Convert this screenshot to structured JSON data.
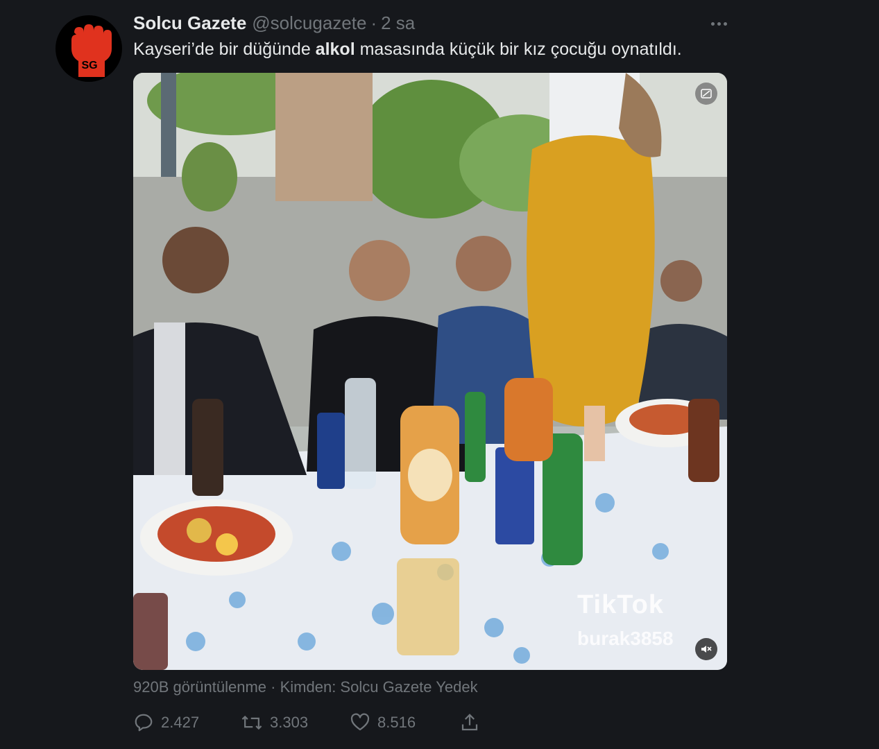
{
  "tweet": {
    "author_name": "Solcu Gazete",
    "handle": "@solcugazete",
    "separator": "·",
    "time": "2 sa",
    "avatar_text": "SG",
    "text_before": "Kayseri’de bir düğünde ",
    "text_bold": "alkol",
    "text_after": " masasında küçük bir kız çocuğu oynatıldı.",
    "more_icon": "more-dots-icon"
  },
  "media": {
    "type": "video",
    "watermark_app": "TikTok",
    "watermark_user": "burak3858",
    "badge_icon": "gif-badge-icon",
    "mute_icon": "muted-speaker-icon"
  },
  "meta": {
    "views": "920B görüntülenme",
    "separator": "·",
    "source": "Kimden: Solcu Gazete Yedek"
  },
  "actions": {
    "reply_count": "2.427",
    "retweet_count": "3.303",
    "like_count": "8.516",
    "reply_icon": "reply-icon",
    "retweet_icon": "retweet-icon",
    "like_icon": "heart-icon",
    "share_icon": "share-icon"
  },
  "colors": {
    "background": "#16181c",
    "primary_text": "#e7e9ea",
    "secondary_text": "#71767b",
    "avatar_red": "#e0321e"
  }
}
